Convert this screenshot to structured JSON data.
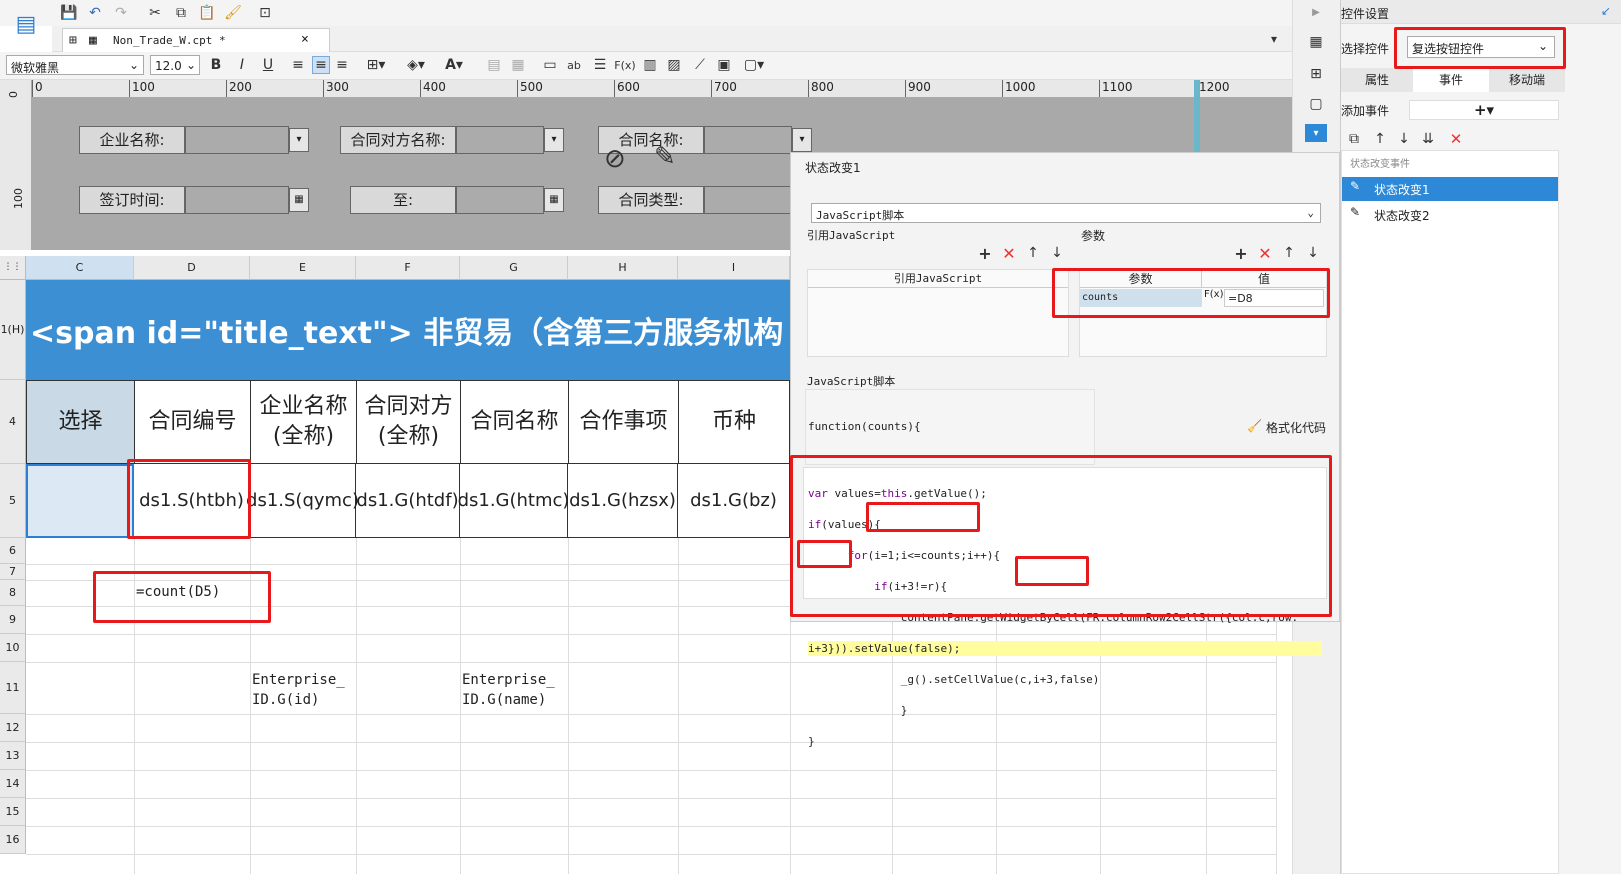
{
  "toolbar": {
    "file_tab": "Non_Trade_W.cpt *",
    "font_name": "微软雅黑",
    "font_size": "12.0"
  },
  "ruler": {
    "marks": [
      "0",
      "100",
      "200",
      "300",
      "400",
      "500",
      "600",
      "700",
      "800",
      "900",
      "1000",
      "1100",
      "1200"
    ],
    "vmarks": [
      "0",
      "100"
    ]
  },
  "form": {
    "company_label": "企业名称:",
    "counterparty_label": "合同对方名称:",
    "contract_name_label": "合同名称:",
    "sign_time_label": "签订时间:",
    "to_label": "至:",
    "contract_type_label": "合同类型:"
  },
  "sheet": {
    "columns": [
      "C",
      "D",
      "E",
      "F",
      "G",
      "H",
      "I"
    ],
    "rows": [
      "1(H)",
      "4",
      "5",
      "6",
      "7",
      "8",
      "9",
      "10",
      "11",
      "12",
      "13",
      "14",
      "15",
      "16"
    ],
    "title": "<span id=\"title_text\"> 非贸易（含第三方服务机构",
    "headers": [
      "选择",
      "合同编号",
      "企业名称\n(全称)",
      "合同对方\n(全称)",
      "合同名称",
      "合作事项",
      "币种"
    ],
    "row5": [
      "ds1.S(htbh)",
      "ds1.S(qymc)",
      "ds1.G(htdf)",
      "ds1.G(htmc)",
      "ds1.G(hzsx)",
      "ds1.G(bz)"
    ],
    "d8": "=count(D5)",
    "e11": "Enterprise_\nID.G(id)",
    "g11": "Enterprise_\nID.G(name)"
  },
  "dialog": {
    "title": "状态改变1",
    "type_select": "JavaScript脚本",
    "ref_js_label": "引用JavaScript",
    "param_label": "参数",
    "ref_js_header": "引用JavaScript",
    "param_header": "参数",
    "value_header": "值",
    "param_name": "counts",
    "param_value": "=D8",
    "js_label": "JavaScript脚本",
    "func_sig": "function(counts){",
    "format_code": "格式化代码",
    "code": {
      "l1a": "var",
      "l1b": " values=",
      "l1c": "this",
      "l1d": ".getValue();",
      "l2a": "if",
      "l2b": "(values){",
      "l3a": "for",
      "l3b": "(i=1;i<=counts;i++){",
      "l4a": "if",
      "l4b": "(i+3!=r){",
      "l5": "contentPane.getWidgetByCell(FR.columnRow2CellStr({col:c,row:",
      "l6a": "i+3}))",
      "l6b": ".setValue(false);",
      "l7": "_g().setCellValue(c,i+3,false)",
      "l8": "}",
      "l9": "}"
    }
  },
  "right": {
    "title": "控件设置",
    "select_label": "选择控件",
    "select_value": "复选按钮控件",
    "tabs": [
      "属性",
      "事件",
      "移动端"
    ],
    "add_event_label": "添加事件",
    "group_label": "状态改变事件",
    "events": [
      "状态改变1",
      "状态改变2"
    ]
  }
}
